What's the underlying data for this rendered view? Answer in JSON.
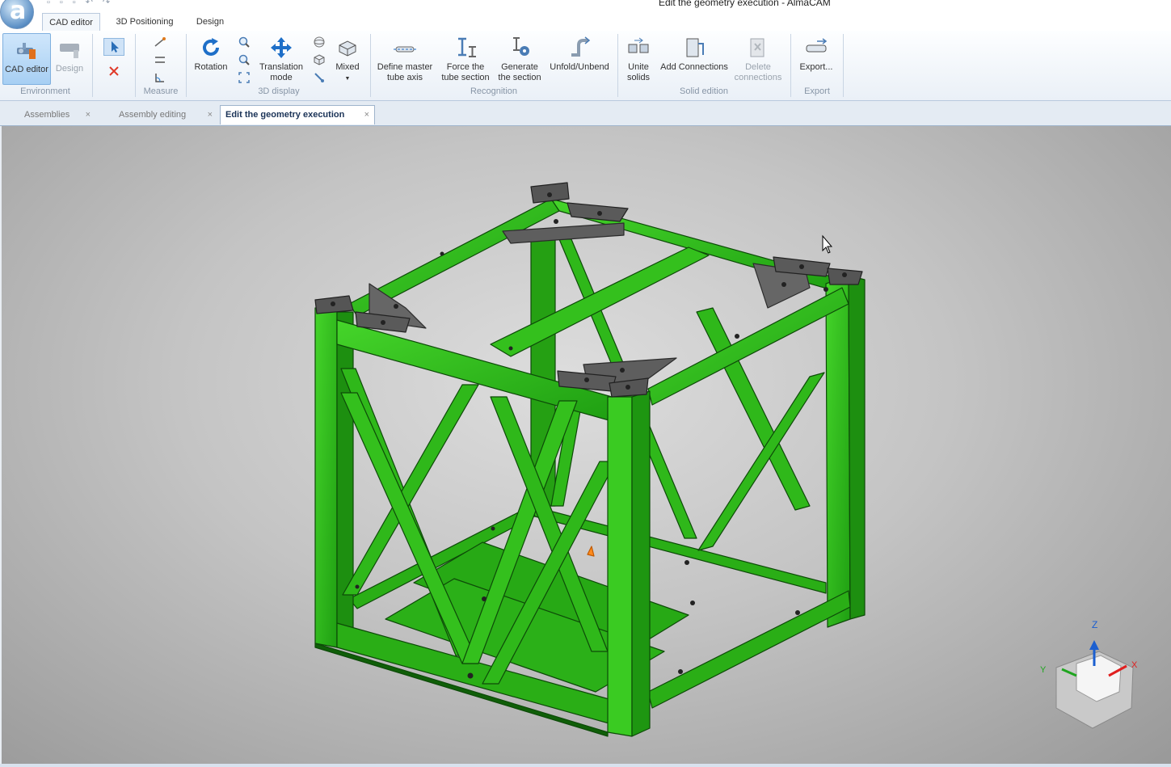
{
  "window": {
    "title": "Edit the geometry execution - AlmaCAM",
    "logo_letter": "a"
  },
  "ribbon_tabs": [
    {
      "label": "CAD editor",
      "active": true
    },
    {
      "label": "3D Positioning",
      "active": false
    },
    {
      "label": "Design",
      "active": false
    }
  ],
  "ribbon": {
    "cad_editor": "CAD editor",
    "design": "Design",
    "rotation": "Rotation",
    "translation_l1": "Translation",
    "translation_l2": "mode",
    "mixed": "Mixed",
    "define_l1": "Define master",
    "define_l2": "tube axis",
    "force_l1": "Force the",
    "force_l2": "tube section",
    "generate_l1": "Generate",
    "generate_l2": "the section",
    "unfold": "Unfold/Unbend",
    "unite_l1": "Unite",
    "unite_l2": "solids",
    "add_connections": "Add Connections",
    "delete_l1": "Delete",
    "delete_l2": "connections",
    "export": "Export..."
  },
  "groups": {
    "environment": "Environment",
    "measure": "Measure",
    "display3d": "3D display",
    "recognition": "Recognition",
    "solid_edition": "Solid edition",
    "export": "Export"
  },
  "doc_tabs": [
    {
      "label": "Assemblies",
      "active": false
    },
    {
      "label": "Assembly editing",
      "active": false
    },
    {
      "label": "Edit the geometry execution",
      "active": true
    }
  ],
  "close_glyph": "×",
  "axes": {
    "z": "Z",
    "y": "Y",
    "x": "X"
  },
  "colors": {
    "frame_green": "#2fbf1a",
    "plate_gray": "#5e5e5e",
    "accent_blue": "#2a7fd0"
  }
}
